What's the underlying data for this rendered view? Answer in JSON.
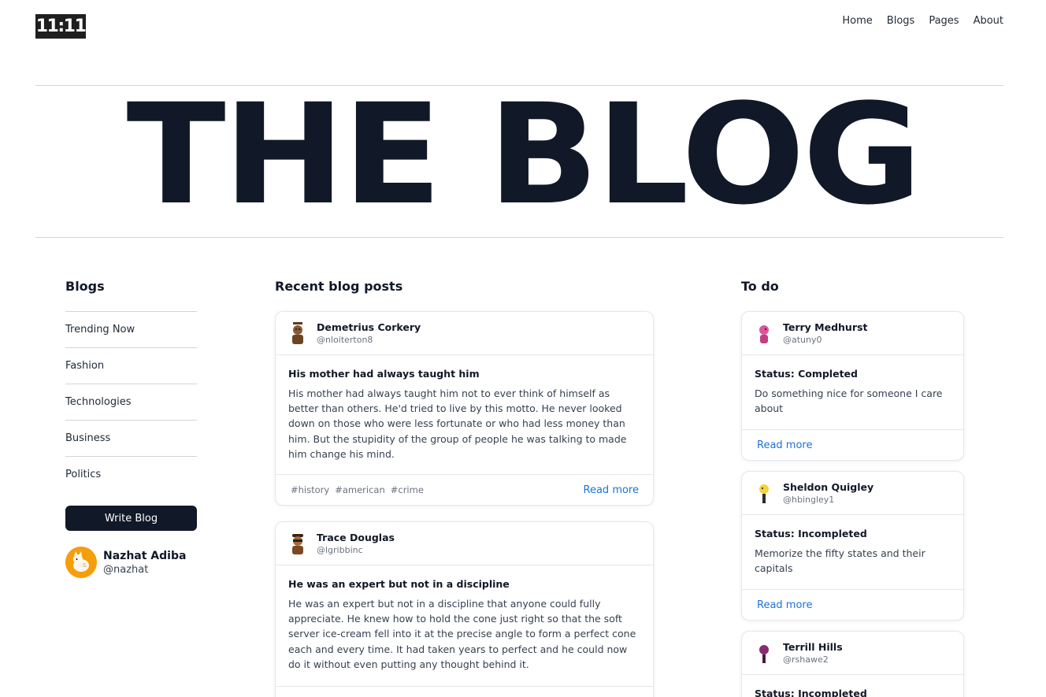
{
  "header": {
    "logo": "11:11",
    "nav": [
      "Home",
      "Blogs",
      "Pages",
      "About"
    ]
  },
  "hero_title": "THE BLOG",
  "sidebar": {
    "title": "Blogs",
    "items": [
      "Trending Now",
      "Fashion",
      "Technologies",
      "Business",
      "Politics"
    ],
    "write_button": "Write Blog",
    "profile": {
      "name": "Nazhat Adiba",
      "handle": "@nazhat"
    }
  },
  "posts": {
    "title": "Recent blog posts",
    "read_more": "Read more",
    "items": [
      {
        "author": "Demetrius Corkery",
        "handle": "@nloiterton8",
        "title": "His mother had always taught him",
        "body": "His mother had always taught him not to ever think of himself as better than others. He'd tried to live by this motto. He never looked down on those who were less fortunate or who had less money than him. But the stupidity of the group of people he was talking to made him change his mind.",
        "tags": [
          "#history",
          "#american",
          "#crime"
        ]
      },
      {
        "author": "Trace Douglas",
        "handle": "@lgribbinc",
        "title": "He was an expert but not in a discipline",
        "body": "He was an expert but not in a discipline that anyone could fully appreciate. He knew how to hold the cone just right so that the soft server ice-cream fell into it at the precise angle to form a perfect cone each and every time. It had taken years to perfect and he could now do it without even putting any thought behind it.",
        "tags": []
      }
    ]
  },
  "todos": {
    "title": "To do",
    "read_more": "Read more",
    "items": [
      {
        "author": "Terry Medhurst",
        "handle": "@atuny0",
        "status": "Status: Completed",
        "text": "Do something nice for someone I care about",
        "color": "#e0559a"
      },
      {
        "author": "Sheldon Quigley",
        "handle": "@hbingley1",
        "status": "Status: Incompleted",
        "text": "Memorize the fifty states and their capitals",
        "color": "#f2d43a"
      },
      {
        "author": "Terrill Hills",
        "handle": "@rshawe2",
        "status": "Status: Incompleted",
        "text": "",
        "color": "#8b2a6e"
      }
    ]
  }
}
